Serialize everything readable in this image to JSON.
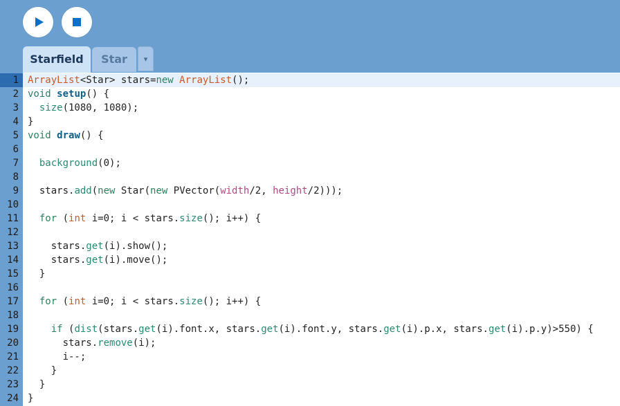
{
  "toolbar": {
    "run_icon": "play-icon",
    "stop_icon": "stop-icon",
    "accent_color": "#6a9fd0"
  },
  "tabs": [
    {
      "label": "Starfield",
      "active": true
    },
    {
      "label": "Star",
      "active": false
    }
  ],
  "tab_menu_icon": "▾",
  "editor": {
    "current_line": 1,
    "lines": [
      {
        "n": "1",
        "tokens": [
          [
            "type",
            "ArrayList"
          ],
          [
            "plain",
            "<Star> stars="
          ],
          [
            "kw",
            "new"
          ],
          [
            "plain",
            " "
          ],
          [
            "type",
            "ArrayList"
          ],
          [
            "plain",
            "();"
          ]
        ]
      },
      {
        "n": "2",
        "tokens": [
          [
            "kw",
            "void"
          ],
          [
            "plain",
            " "
          ],
          [
            "fn",
            "setup"
          ],
          [
            "plain",
            "() {"
          ]
        ]
      },
      {
        "n": "3",
        "tokens": [
          [
            "plain",
            "  "
          ],
          [
            "call",
            "size"
          ],
          [
            "plain",
            "(1080, 1080);"
          ]
        ]
      },
      {
        "n": "4",
        "tokens": [
          [
            "plain",
            "}"
          ]
        ]
      },
      {
        "n": "5",
        "tokens": [
          [
            "kw",
            "void"
          ],
          [
            "plain",
            " "
          ],
          [
            "fn",
            "draw"
          ],
          [
            "plain",
            "() {"
          ]
        ]
      },
      {
        "n": "6",
        "tokens": []
      },
      {
        "n": "7",
        "tokens": [
          [
            "plain",
            "  "
          ],
          [
            "call",
            "background"
          ],
          [
            "plain",
            "(0);"
          ]
        ]
      },
      {
        "n": "8",
        "tokens": []
      },
      {
        "n": "9",
        "tokens": [
          [
            "plain",
            "  stars."
          ],
          [
            "call",
            "add"
          ],
          [
            "plain",
            "("
          ],
          [
            "kw",
            "new"
          ],
          [
            "plain",
            " Star("
          ],
          [
            "kw",
            "new"
          ],
          [
            "plain",
            " PVector("
          ],
          [
            "builtin",
            "width"
          ],
          [
            "plain",
            "/2, "
          ],
          [
            "builtin",
            "height"
          ],
          [
            "plain",
            "/2)));"
          ]
        ]
      },
      {
        "n": "10",
        "tokens": []
      },
      {
        "n": "11",
        "tokens": [
          [
            "plain",
            "  "
          ],
          [
            "kw",
            "for"
          ],
          [
            "plain",
            " ("
          ],
          [
            "type",
            "int"
          ],
          [
            "plain",
            " i=0; i < stars."
          ],
          [
            "call",
            "size"
          ],
          [
            "plain",
            "(); i++) {"
          ]
        ]
      },
      {
        "n": "12",
        "tokens": []
      },
      {
        "n": "13",
        "tokens": [
          [
            "plain",
            "    stars."
          ],
          [
            "call",
            "get"
          ],
          [
            "plain",
            "(i).show();"
          ]
        ]
      },
      {
        "n": "14",
        "tokens": [
          [
            "plain",
            "    stars."
          ],
          [
            "call",
            "get"
          ],
          [
            "plain",
            "(i).move();"
          ]
        ]
      },
      {
        "n": "15",
        "tokens": [
          [
            "plain",
            "  }"
          ]
        ]
      },
      {
        "n": "16",
        "tokens": []
      },
      {
        "n": "17",
        "tokens": [
          [
            "plain",
            "  "
          ],
          [
            "kw",
            "for"
          ],
          [
            "plain",
            " ("
          ],
          [
            "type",
            "int"
          ],
          [
            "plain",
            " i=0; i < stars."
          ],
          [
            "call",
            "size"
          ],
          [
            "plain",
            "(); i++) {"
          ]
        ]
      },
      {
        "n": "18",
        "tokens": []
      },
      {
        "n": "19",
        "tokens": [
          [
            "plain",
            "    "
          ],
          [
            "kw",
            "if"
          ],
          [
            "plain",
            " ("
          ],
          [
            "call",
            "dist"
          ],
          [
            "plain",
            "(stars."
          ],
          [
            "call",
            "get"
          ],
          [
            "plain",
            "(i).font.x, stars."
          ],
          [
            "call",
            "get"
          ],
          [
            "plain",
            "(i).font.y, stars."
          ],
          [
            "call",
            "get"
          ],
          [
            "plain",
            "(i).p.x, stars."
          ],
          [
            "call",
            "get"
          ],
          [
            "plain",
            "(i).p.y)>550) {"
          ]
        ]
      },
      {
        "n": "20",
        "tokens": [
          [
            "plain",
            "      stars."
          ],
          [
            "call",
            "remove"
          ],
          [
            "plain",
            "(i);"
          ]
        ]
      },
      {
        "n": "21",
        "tokens": [
          [
            "plain",
            "      i--;"
          ]
        ]
      },
      {
        "n": "22",
        "tokens": [
          [
            "plain",
            "    }"
          ]
        ]
      },
      {
        "n": "23",
        "tokens": [
          [
            "plain",
            "  }"
          ]
        ]
      },
      {
        "n": "24",
        "tokens": [
          [
            "plain",
            "}"
          ]
        ]
      }
    ]
  }
}
